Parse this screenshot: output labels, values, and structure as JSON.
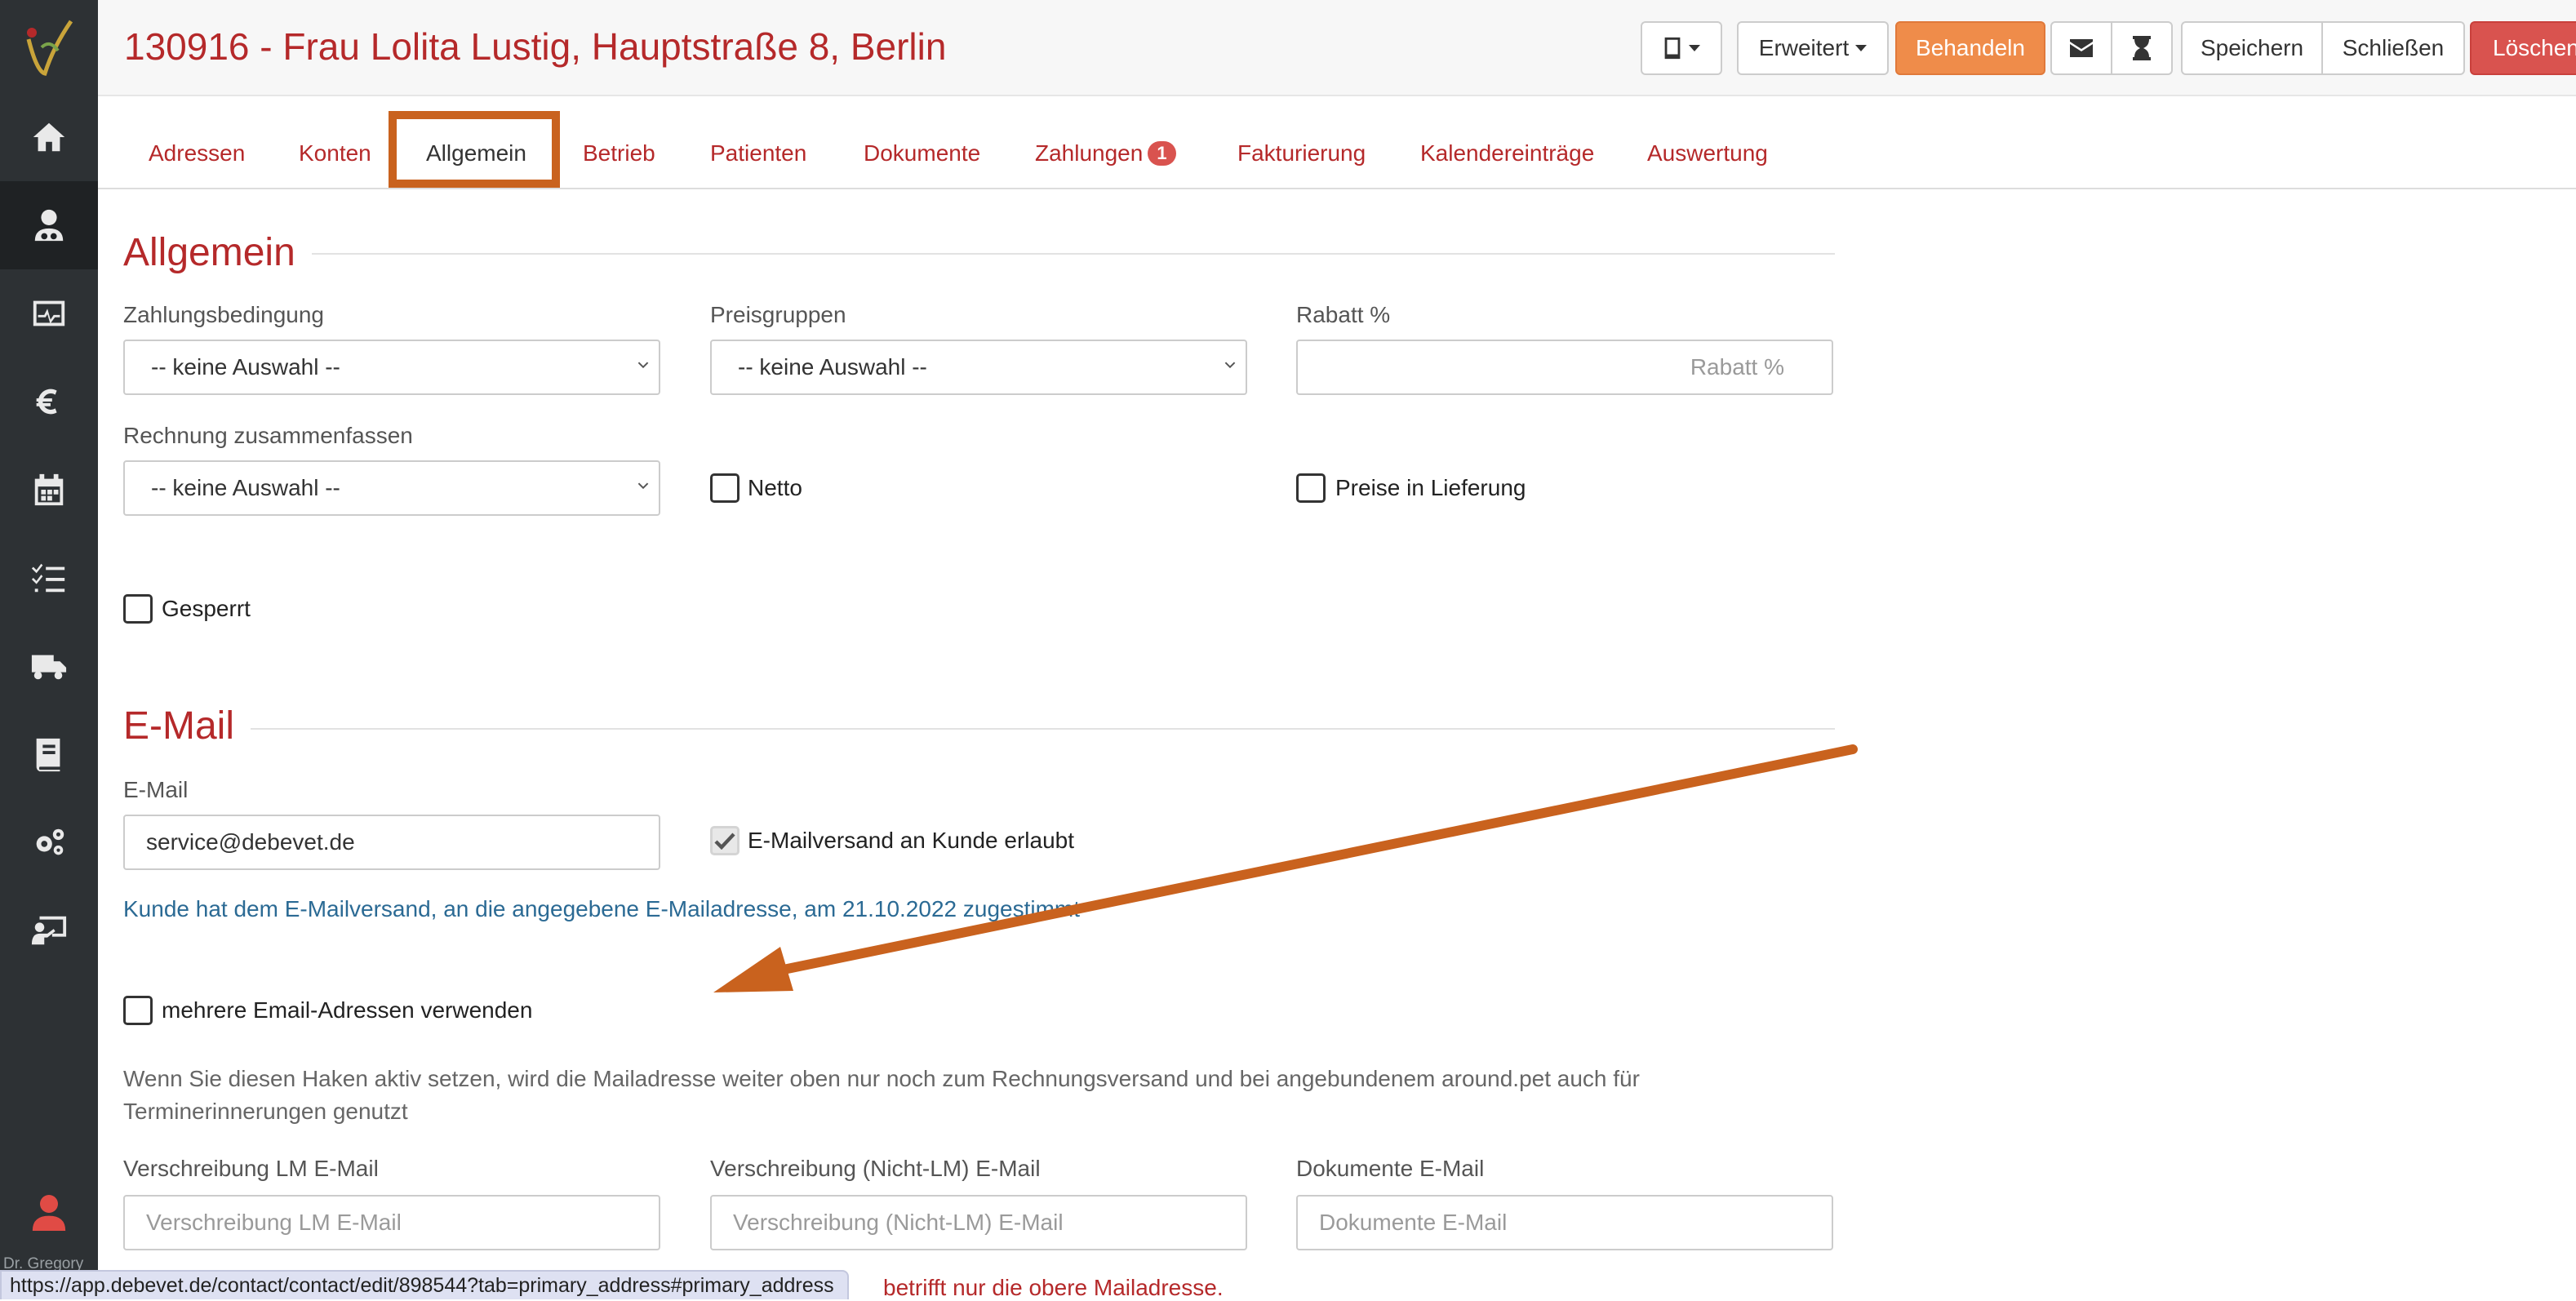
{
  "header": {
    "title": "130916 - Frau Lolita Lustig, Hauptstraße 8, Berlin",
    "buttons": {
      "erweitert": "Erweitert",
      "behandeln": "Behandeln",
      "speichern": "Speichern",
      "schliessen": "Schließen",
      "loeschen": "Löschen"
    }
  },
  "sidebar": {
    "items": [
      "home-icon",
      "client-icon",
      "monitor-icon",
      "euro-icon",
      "calendar-icon",
      "tasks-icon",
      "truck-icon",
      "book-icon",
      "gears-icon",
      "teacher-icon"
    ],
    "active_index": 1,
    "user_name": "Dr. Gregory"
  },
  "tabs": [
    {
      "label": "Adressen"
    },
    {
      "label": "Konten"
    },
    {
      "label": "Allgemein",
      "active": true
    },
    {
      "label": "Betrieb"
    },
    {
      "label": "Patienten"
    },
    {
      "label": "Dokumente"
    },
    {
      "label": "Zahlungen",
      "badge": "1"
    },
    {
      "label": "Fakturierung"
    },
    {
      "label": "Kalendereinträge"
    },
    {
      "label": "Auswertung"
    }
  ],
  "allgemein": {
    "title": "Allgemein",
    "zahlungsbedingung_label": "Zahlungsbedingung",
    "zahlungsbedingung_value": "-- keine Auswahl --",
    "preisgruppen_label": "Preisgruppen",
    "preisgruppen_value": "-- keine Auswahl --",
    "rabatt_label": "Rabatt %",
    "rabatt_placeholder": "Rabatt %",
    "rechnung_label": "Rechnung zusammenfassen",
    "rechnung_value": "-- keine Auswahl --",
    "netto_label": "Netto",
    "preise_label": "Preise in Lieferung",
    "gesperrt_label": "Gesperrt"
  },
  "email": {
    "title": "E-Mail",
    "email_label": "E-Mail",
    "email_value": "service@debevet.de",
    "versand_label": "E-Mailversand an Kunde erlaubt",
    "versand_checked": true,
    "consent_text": "Kunde hat dem E-Mailversand, an die angegebene E-Mailadresse, am 21.10.2022 zugestimmt",
    "mehrere_label": "mehrere Email-Adressen verwenden",
    "help_text": "Wenn Sie diesen Haken aktiv setzen, wird die Mailadresse weiter oben nur noch zum Rechnungsversand und bei angebundenem around.pet auch für Terminerinnerungen genutzt",
    "lm_label": "Verschreibung LM E-Mail",
    "lm_placeholder": "Verschreibung LM E-Mail",
    "nicht_lm_label": "Verschreibung (Nicht-LM) E-Mail",
    "nicht_lm_placeholder": "Verschreibung (Nicht-LM) E-Mail",
    "dokumente_label": "Dokumente E-Mail",
    "dokumente_placeholder": "Dokumente E-Mail",
    "bottom_note": "betrifft nur die obere Mailadresse."
  },
  "statusbar": {
    "url": "https://app.debevet.de/contact/contact/edit/898544?tab=primary_address#primary_address"
  },
  "annotation": {
    "color": "#c9621e"
  }
}
